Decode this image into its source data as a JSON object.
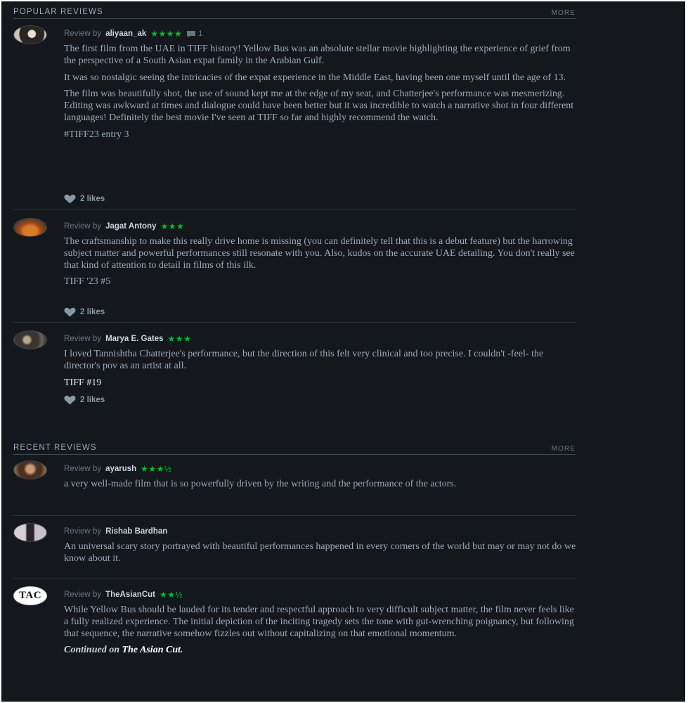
{
  "popular": {
    "title": "POPULAR REVIEWS",
    "more": "MORE",
    "reviews": [
      {
        "byline_prefix": "Review by",
        "author": "aliyaan_ak",
        "stars": "★★★★",
        "comments": "1",
        "paragraphs": [
          "The first film from the UAE in TIFF history! Yellow Bus was an absolute stellar movie highlighting the experience of grief from the perspective of a South Asian expat family in the Arabian Gulf.",
          "It was so nostalgic seeing the intricacies of the expat experience in the Middle East, having been one myself until the age of 13.",
          "The film was beautifully shot, the use of sound kept me at the edge of my seat, and Chatterjee's performance was mesmerizing. Editing was awkward at times and dialogue could have been better but it was incredible to watch a narrative shot in four different languages! Definitely the best movie I've seen at TIFF so far and highly recommend the watch.",
          "#TIFF23 entry 3"
        ],
        "likes": "2 likes"
      },
      {
        "byline_prefix": "Review by",
        "author": "Jagat Antony",
        "stars": "★★★",
        "paragraphs": [
          "The craftsmanship to make this really drive home is missing (you can definitely tell that this is a debut feature) but the harrowing subject matter and powerful performances still resonate with you.  Also, kudos on the accurate UAE detailing. You don't really see that kind of attention to detail in films of this ilk.",
          "TIFF '23 #5"
        ],
        "likes": "2 likes"
      },
      {
        "byline_prefix": "Review by",
        "author": "Marya E. Gates",
        "stars": "★★★",
        "paragraphs": [
          "I loved Tannishtha Chatterjee's performance, but the direction of this felt very clinical and too precise. I couldn't -feel- the director's pov as an artist at all.",
          "TIFF #19"
        ],
        "likes": "2 likes"
      }
    ]
  },
  "recent": {
    "title": "RECENT REVIEWS",
    "more": "MORE",
    "reviews": [
      {
        "byline_prefix": "Review by",
        "author": "ayarush",
        "stars": "★★★½",
        "paragraphs": [
          "a very well-made film that is so powerfully driven by the writing and the performance of the actors."
        ]
      },
      {
        "byline_prefix": "Review by",
        "author": "Rishab Bardhan",
        "paragraphs": [
          "An universal scary story portrayed with beautiful performances happened in every corners of the world but may or may not do we know about it."
        ]
      },
      {
        "byline_prefix": "Review by",
        "author": "TheAsianCut",
        "avatar_text": "TAC",
        "stars": "★★½",
        "paragraphs": [
          "While Yellow Bus should be lauded for its tender and respectful approach to very difficult subject matter, the film never feels like a fully realized experience. The initial depiction of the inciting tragedy sets the tone with gut-wrenching poignancy, but following that sequence, the narrative somehow fizzles out without capitalizing on that emotional momentum."
        ],
        "continued_prefix": "Continued on",
        "continued_link": "The Asian Cut",
        "continued_suffix": "."
      }
    ]
  },
  "colors": {
    "background": "#14181c",
    "star_green": "#00c030",
    "text_muted": "#99aabb",
    "text_author": "#c8d4de"
  },
  "icons": [
    "heart-icon",
    "comment-icon"
  ]
}
